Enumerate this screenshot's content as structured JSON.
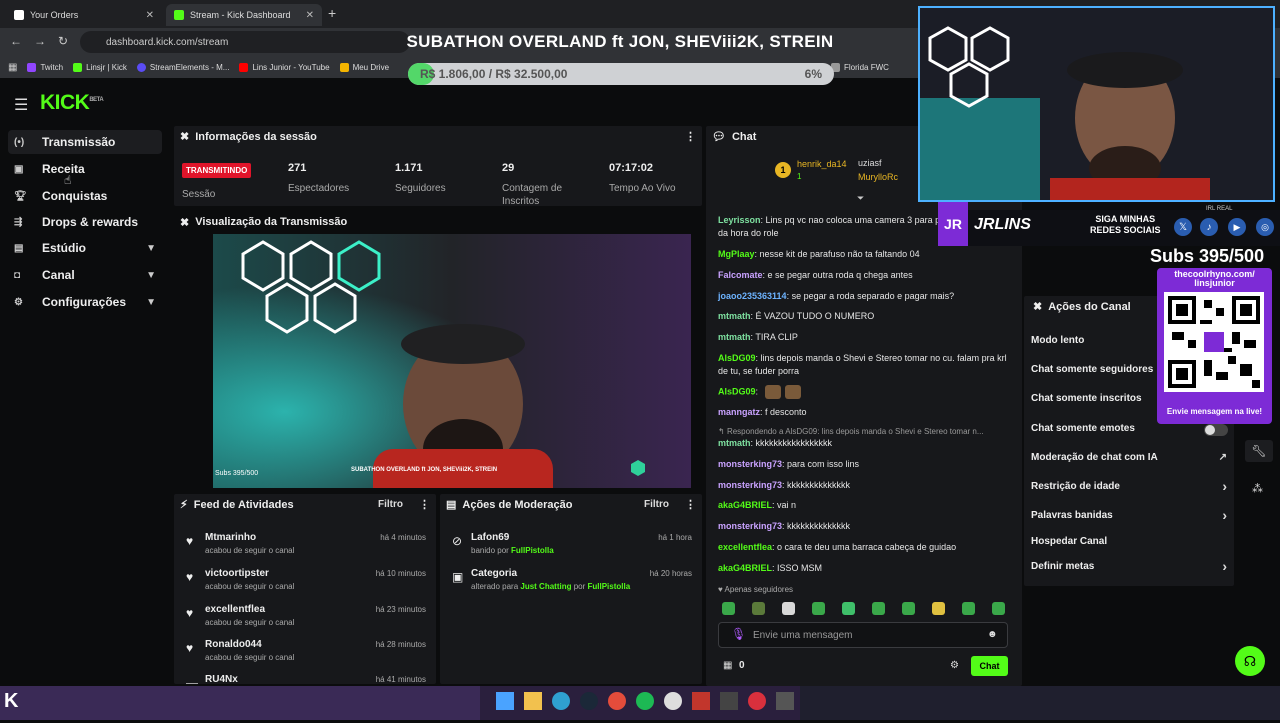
{
  "browser": {
    "tabs": [
      {
        "label": "Your Orders"
      },
      {
        "label": "Stream - Kick Dashboard"
      }
    ],
    "url": "dashboard.kick.com/stream",
    "bookmarks": [
      "Twitch",
      "Linsjr | Kick",
      "StreamElements - M...",
      "Lins Junior - YouTube",
      "Meu Drive",
      "Florida FWC"
    ]
  },
  "overlay": {
    "title": "SUBATHON OVERLAND ft JON, SHEViii2K, STREIN",
    "goal_text": "R$ 1.806,00 / R$ 32.500,00",
    "goal_pct": "6%",
    "goal_fraction": 0.06,
    "subs_big": "Subs 395/500",
    "qr_url": "thecoolrhyno.com/ linsjunior",
    "qr_caption": "Envie mensagem na live!",
    "social_handle": "JRLINS",
    "social_text1": "SIGA MINHAS",
    "social_text2": "REDES SOCIAIS",
    "irl_label": "IRL REAL"
  },
  "brand": {
    "logo": "KICK",
    "beta": "BETA",
    "accent": "#53fc18"
  },
  "sidebar": {
    "items": [
      {
        "label": "Transmissão",
        "icon": "broadcast-icon"
      },
      {
        "label": "Receita",
        "icon": "revenue-icon"
      },
      {
        "label": "Conquistas",
        "icon": "trophy-icon"
      },
      {
        "label": "Drops & rewards",
        "icon": "drops-icon"
      },
      {
        "label": "Estúdio",
        "icon": "studio-icon"
      },
      {
        "label": "Canal",
        "icon": "channel-icon"
      },
      {
        "label": "Configurações",
        "icon": "gear-icon"
      }
    ]
  },
  "session": {
    "title": "Informações da sessão",
    "status": "TRANSMITINDO",
    "status_label": "Sessão",
    "stats": [
      {
        "value": "271",
        "label": "Espectadores"
      },
      {
        "value": "1.171",
        "label": "Seguidores"
      },
      {
        "value": "29",
        "label": "Contagem de Inscritos"
      },
      {
        "value": "07:17:02",
        "label": "Tempo Ao Vivo"
      }
    ]
  },
  "preview": {
    "title": "Visualização da Transmissão",
    "subs_small": "Subs 395/500",
    "overlay_small": "SUBATHON OVERLAND ft JON, SHEViii2K, STREIN"
  },
  "feed": {
    "title": "Feed de Atividades",
    "filter": "Filtro",
    "items": [
      {
        "name": "Mtmarinho",
        "action": "acabou de seguir o canal",
        "time": "há 4 minutos"
      },
      {
        "name": "victoortipster",
        "action": "acabou de seguir o canal",
        "time": "há 10 minutos"
      },
      {
        "name": "excellentflea",
        "action": "acabou de seguir o canal",
        "time": "há 23 minutos"
      },
      {
        "name": "Ronaldo044",
        "action": "acabou de seguir o canal",
        "time": "há 28 minutos"
      },
      {
        "name": "RU4Nx",
        "action": "",
        "time": "há 41 minutos"
      }
    ]
  },
  "moderation": {
    "title": "Ações de Moderação",
    "filter": "Filtro",
    "items": [
      {
        "name": "Lafon69",
        "pre": "banido por ",
        "by": "FullPistolla",
        "time": "há 1 hora"
      },
      {
        "name": "Categoria",
        "pre": "alterado para ",
        "cat": "Just Chatting",
        "mid": " por ",
        "by": "FullPistolla",
        "time": "há 20 horas"
      }
    ]
  },
  "chat": {
    "title": "Chat",
    "pinned": {
      "user1": "henrik_da14",
      "count": "1",
      "user2": "uziasf",
      "user3": "MurylloRc"
    },
    "messages": [
      {
        "user": "Leyrisson",
        "color": "#7ee0a0",
        "text": ": Lins pq vc nao coloca uma camera 3 para poder ter imagens da hora do role"
      },
      {
        "user": "MgPlaay",
        "color": "#53fc18",
        "text": ": nesse kit de parafuso não ta faltando 04"
      },
      {
        "user": "Falcomate",
        "color": "#c9a2ff",
        "text": ": e se pegar outra roda q chega antes"
      },
      {
        "user": "joaoo235363114",
        "color": "#6db3ff",
        "text": ": se pegar a roda separado e pagar mais?"
      },
      {
        "user": "mtmath",
        "color": "#7ee0a0",
        "text": ": É VAZOU TUDO O NUMERO"
      },
      {
        "user": "mtmath",
        "color": "#7ee0a0",
        "text": ": TIRA CLIP"
      },
      {
        "user": "AlsDG09",
        "color": "#53fc18",
        "text": ": lins depois manda o Shevi e Stereo tomar no cu. falam pra krl de tu, se fuder porra"
      },
      {
        "user": "AlsDG09",
        "color": "#53fc18",
        "text": ":"
      },
      {
        "user": "manngatz",
        "color": "#c9a2ff",
        "text": ": f desconto"
      },
      {
        "user": "",
        "color": "#999",
        "text": "Respondendo a AlsDG09: lins depois manda o Shevi e Stereo tomar n..."
      },
      {
        "user": "mtmath",
        "color": "#7ee0a0",
        "text": ": kkkkkkkkkkkkkkkkk"
      },
      {
        "user": "monsterking73",
        "color": "#c9a2ff",
        "text": ": para com isso lins"
      },
      {
        "user": "monsterking73",
        "color": "#c9a2ff",
        "text": ": kkkkkkkkkkkkkk"
      },
      {
        "user": "akaG4BRIEL",
        "color": "#53fc18",
        "text": ": vai n"
      },
      {
        "user": "monsterking73",
        "color": "#c9a2ff",
        "text": ": kkkkkkkkkkkkkk"
      },
      {
        "user": "excellentflea",
        "color": "#53fc18",
        "text": ": o cara te deu uma barraca cabeça de guidao"
      },
      {
        "user": "akaG4BRIEL",
        "color": "#53fc18",
        "text": ": ISSO MSM"
      }
    ],
    "mode": "Apenas seguidores",
    "placeholder": "Envie uma mensagem",
    "points": "0",
    "send": "Chat"
  },
  "channel_actions": {
    "title": "Ações do Canal",
    "items": [
      {
        "label": "Modo lento",
        "chev": ""
      },
      {
        "label": "Chat somente seguidores",
        "chev": ""
      },
      {
        "label": "Chat somente inscritos",
        "chev": ""
      },
      {
        "label": "Chat somente emotes",
        "chev": ""
      },
      {
        "label": "Moderação de chat com IA",
        "chev": "↗"
      },
      {
        "label": "Restrição de idade",
        "chev": "›"
      },
      {
        "label": "Palavras banidas",
        "chev": "›"
      },
      {
        "label": "Hospedar Canal",
        "chev": ""
      },
      {
        "label": "Definir metas",
        "chev": "›"
      }
    ]
  }
}
